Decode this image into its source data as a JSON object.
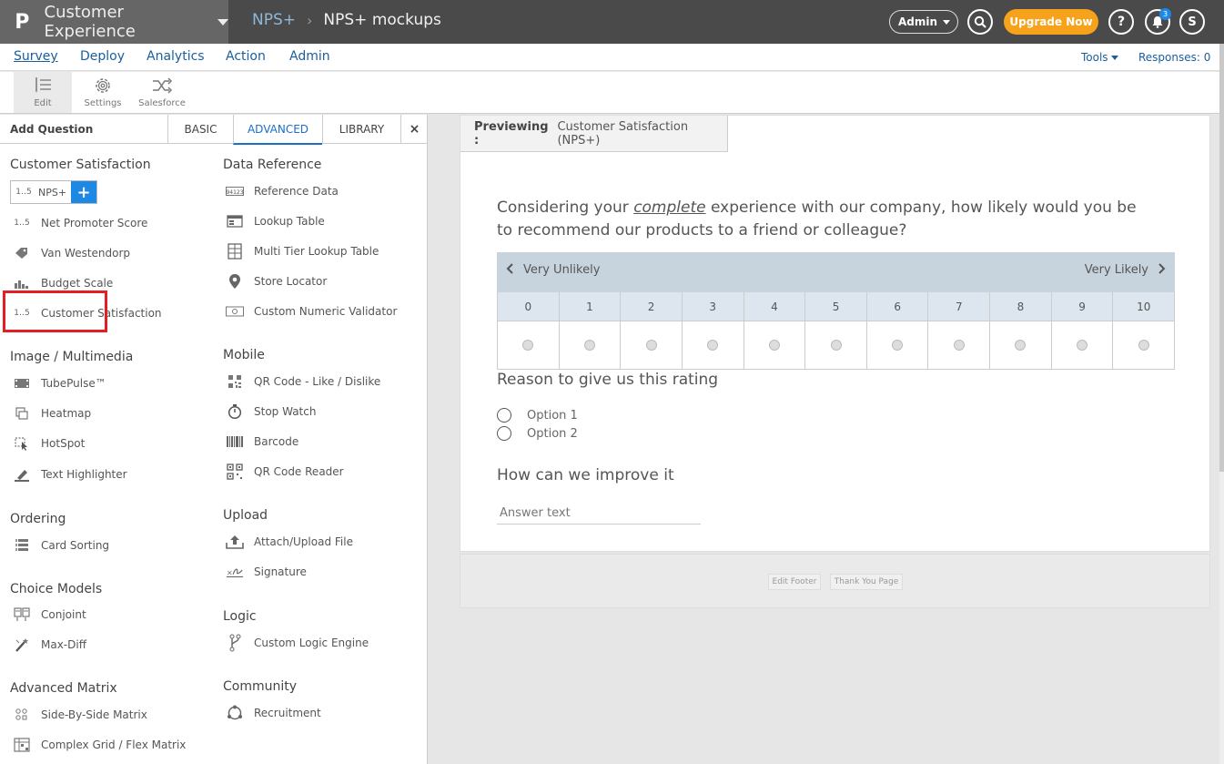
{
  "app": {
    "logo_glyph": "P",
    "title": "Customer Experience"
  },
  "breadcrumb": {
    "parent": "NPS+",
    "separator": "›",
    "current": "NPS+ mockups"
  },
  "header": {
    "admin_label": "Admin",
    "upgrade_label": "Upgrade Now",
    "help_glyph": "?",
    "notification_count": "3",
    "user_initial": "S"
  },
  "nav": {
    "items": [
      "Survey",
      "Deploy",
      "Analytics",
      "Action",
      "Admin"
    ],
    "tools_label": "Tools",
    "responses_label": "Responses: 0"
  },
  "toolbar": {
    "edit_label": "Edit",
    "settings_label": "Settings",
    "salesforce_label": "Salesforce"
  },
  "panel": {
    "header_label": "Add Question",
    "tabs": [
      "BASIC",
      "ADVANCED",
      "LIBRARY"
    ],
    "close_glyph": "×",
    "add_glyph": "+",
    "sections": {
      "customer_satisfaction": {
        "title": "Customer Satisfaction",
        "items": [
          "NPS+",
          "Net Promoter Score",
          "Van Westendorp",
          "Budget Scale",
          "Customer Satisfaction"
        ]
      },
      "image_multimedia": {
        "title": "Image / Multimedia",
        "items": [
          "TubePulse™",
          "Heatmap",
          "HotSpot",
          "Text Highlighter"
        ]
      },
      "ordering": {
        "title": "Ordering",
        "items": [
          "Card Sorting"
        ]
      },
      "choice_models": {
        "title": "Choice Models",
        "items": [
          "Conjoint",
          "Max-Diff"
        ]
      },
      "advanced_matrix": {
        "title": "Advanced Matrix",
        "items": [
          "Side-By-Side Matrix",
          "Complex Grid / Flex Matrix"
        ]
      },
      "data_reference": {
        "title": "Data Reference",
        "items": [
          "Reference Data",
          "Lookup Table",
          "Multi Tier Lookup Table",
          "Store Locator",
          "Custom Numeric Validator"
        ]
      },
      "mobile": {
        "title": "Mobile",
        "items": [
          "QR Code - Like / Dislike",
          "Stop Watch",
          "Barcode",
          "QR Code Reader"
        ]
      },
      "upload": {
        "title": "Upload",
        "items": [
          "Attach/Upload File",
          "Signature"
        ]
      },
      "logic": {
        "title": "Logic",
        "items": [
          "Custom Logic Engine"
        ]
      },
      "community": {
        "title": "Community",
        "items": [
          "Recruitment"
        ]
      }
    }
  },
  "preview": {
    "label_prefix": "Previewing :",
    "label_value": "Customer Satisfaction (NPS+)",
    "q1": {
      "before": "Considering your ",
      "emphasis": "complete",
      "after": " experience with our company, how likely would you be to recommend our products to a friend or colleague?"
    },
    "scale": {
      "low_label": "Very Unlikely",
      "high_label": "Very Likely",
      "points": [
        "0",
        "1",
        "2",
        "3",
        "4",
        "5",
        "6",
        "7",
        "8",
        "9",
        "10"
      ]
    },
    "q2": {
      "title": "Reason to give us this rating",
      "options": [
        "Option 1",
        "Option 2"
      ]
    },
    "q3": {
      "title": "How can we improve it",
      "placeholder": "Answer text"
    },
    "footer": {
      "edit_footer_label": "Edit Footer",
      "thank_you_label": "Thank You Page"
    }
  },
  "colors": {
    "accent_blue": "#1e88e5",
    "upgrade_orange": "#f7a21b",
    "highlight_red": "#e31e24"
  }
}
